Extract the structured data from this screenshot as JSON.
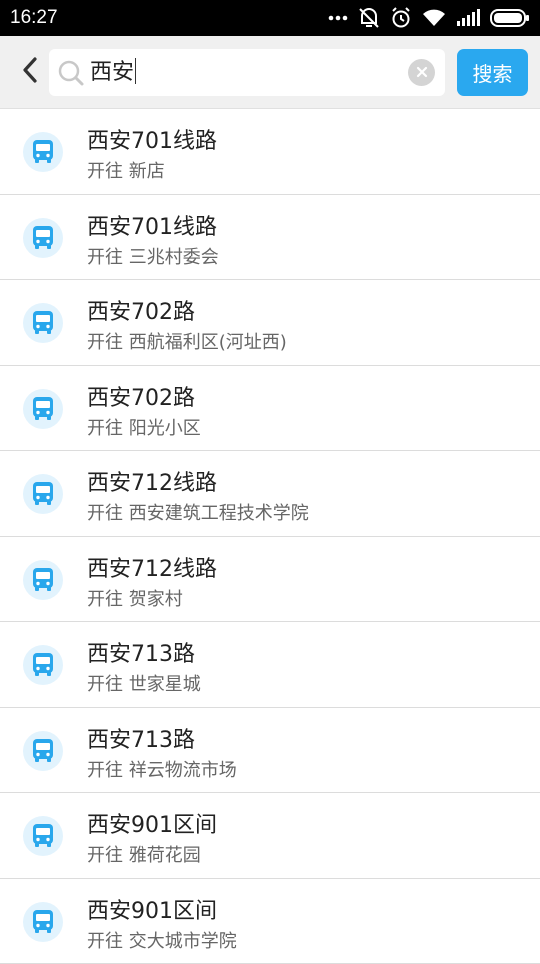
{
  "status_bar": {
    "time": "16:27",
    "icons": [
      "more-dots-icon",
      "vibrate-off-icon",
      "alarm-icon",
      "wifi-icon",
      "signal-icon",
      "battery-icon"
    ]
  },
  "search": {
    "query": "西安",
    "button_label": "搜索",
    "icons": [
      "back-arrow-icon",
      "search-icon",
      "clear-icon"
    ],
    "accent_color": "#2aa8ef"
  },
  "results": [
    {
      "name": "西安701线路",
      "prefix": "开往",
      "destination": "新店"
    },
    {
      "name": "西安701线路",
      "prefix": "开往",
      "destination": "三兆村委会"
    },
    {
      "name": "西安702路",
      "prefix": "开往",
      "destination": "西航福利区(河址西)"
    },
    {
      "name": "西安702路",
      "prefix": "开往",
      "destination": "阳光小区"
    },
    {
      "name": "西安712线路",
      "prefix": "开往",
      "destination": "西安建筑工程技术学院"
    },
    {
      "name": "西安712线路",
      "prefix": "开往",
      "destination": "贺家村"
    },
    {
      "name": "西安713路",
      "prefix": "开往",
      "destination": "世家星城"
    },
    {
      "name": "西安713路",
      "prefix": "开往",
      "destination": "祥云物流市场"
    },
    {
      "name": "西安901区间",
      "prefix": "开往",
      "destination": "雅荷花园"
    },
    {
      "name": "西安901区间",
      "prefix": "开往",
      "destination": "交大城市学院"
    }
  ]
}
